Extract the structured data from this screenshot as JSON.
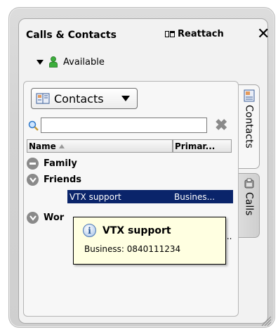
{
  "window": {
    "title": "Calls & Contacts",
    "reattach_label": "Reattach",
    "close_icon": "close-icon"
  },
  "status": {
    "label": "Available",
    "icon": "person-available-icon",
    "color": "#2e9b2e"
  },
  "contacts": {
    "view_selector": "Contacts",
    "search": {
      "value": "",
      "placeholder": ""
    },
    "columns": [
      {
        "label": "Name",
        "sorted": "ascending"
      },
      {
        "label": "Primar..."
      }
    ],
    "groups": [
      {
        "name": "Family",
        "state": "collapsed"
      },
      {
        "name": "Friends",
        "state": "expanded"
      },
      {
        "name": "Wor",
        "state": "expanded"
      }
    ],
    "selected_contact": {
      "name": "VTX support",
      "primary": "Busines..."
    },
    "hidden_cell": "..."
  },
  "tooltip": {
    "title": "VTX support",
    "body": "Business: 0840111234"
  },
  "tabs": [
    {
      "label": "Contacts",
      "active": true,
      "icon": "contacts-book-icon"
    },
    {
      "label": "Calls",
      "active": false,
      "icon": "phone-icon"
    }
  ],
  "colors": {
    "selection": "#0a246a",
    "tooltip_bg": "#ffffe1",
    "accent_blue": "#1d4f91"
  }
}
